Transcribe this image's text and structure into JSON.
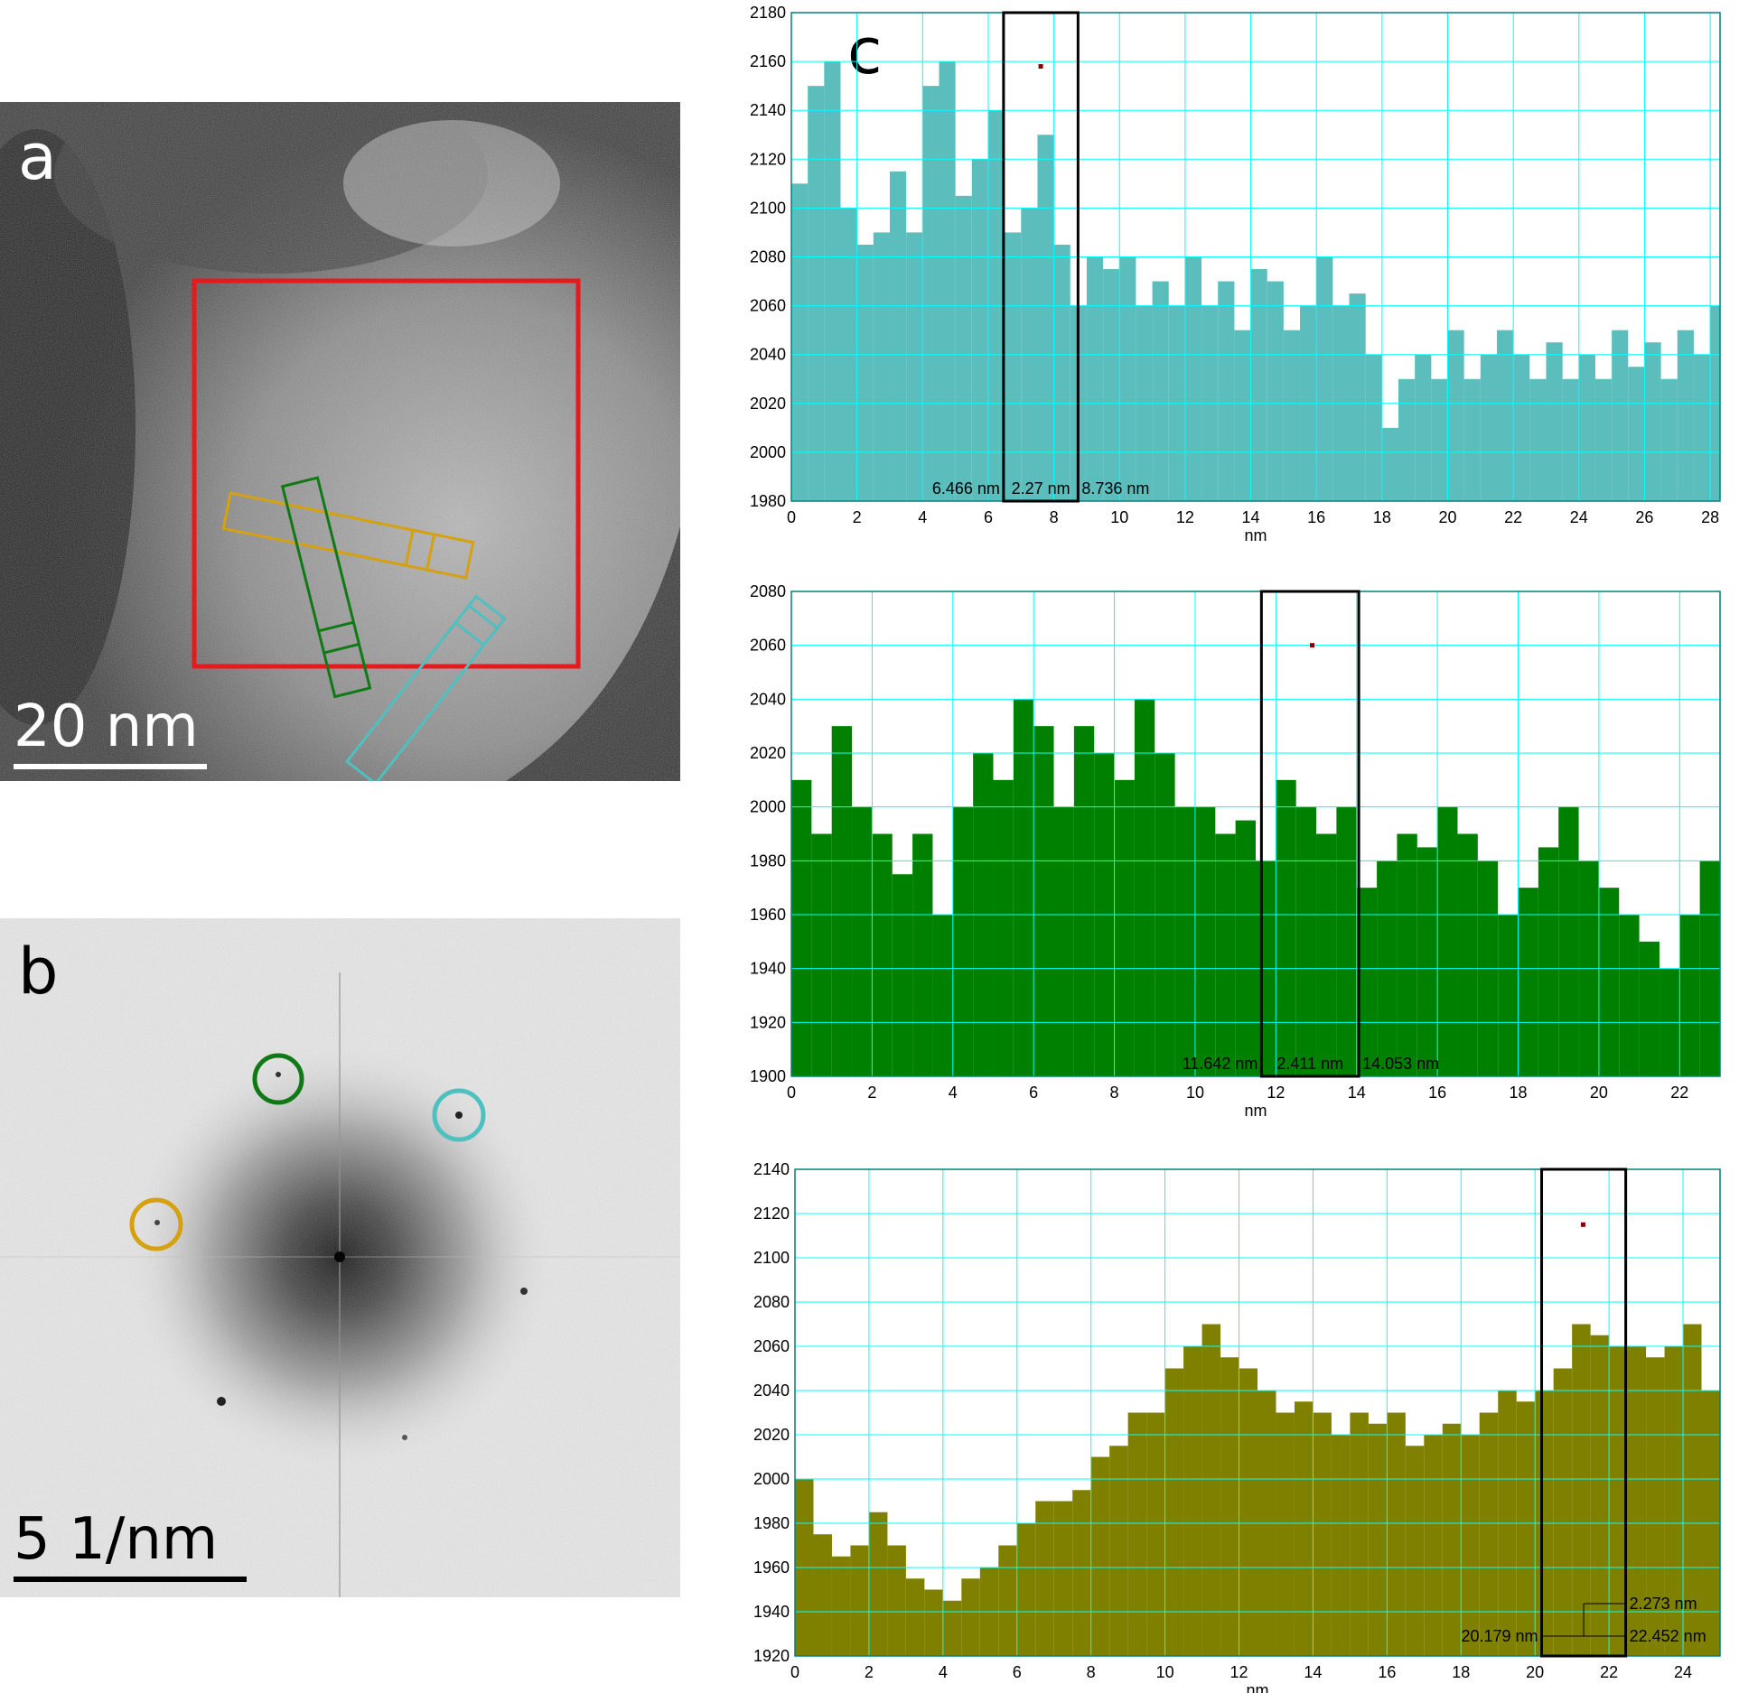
{
  "panel_a": {
    "letter": "a",
    "scale_label": "20 nm",
    "colors": {
      "roi": "#e8191e",
      "gold": "#d6a10e",
      "teal": "#4fc0c0",
      "green": "#0f7a15"
    }
  },
  "panel_b": {
    "letter": "b",
    "scale_label": "5 1/nm",
    "colors": {
      "gold": "#d6a10e",
      "teal": "#4fc0c0",
      "green": "#0f7a15"
    }
  },
  "panel_c": {
    "letter": "c"
  },
  "chart_data": [
    {
      "type": "bar",
      "xlabel": "nm",
      "ylabel": "",
      "xlim": [
        0,
        28.3
      ],
      "ylim": [
        1980,
        2180
      ],
      "xticks": [
        0,
        2,
        4,
        6,
        8,
        10,
        12,
        14,
        16,
        18,
        20,
        22,
        24,
        26,
        28
      ],
      "yticks": [
        1980,
        2000,
        2020,
        2040,
        2060,
        2080,
        2100,
        2120,
        2140,
        2160,
        2180
      ],
      "color": "#5cbdbd",
      "grid": true,
      "selection": [
        6.466,
        8.736
      ],
      "measure_text": [
        "6.466 nm",
        "2.27 nm",
        "8.736 nm"
      ],
      "marker": [
        7.6,
        2158
      ],
      "x": [
        0.0,
        0.5,
        1.0,
        1.5,
        2.0,
        2.5,
        3.0,
        3.5,
        4.0,
        4.5,
        5.0,
        5.5,
        6.0,
        6.5,
        7.0,
        7.5,
        8.0,
        8.5,
        9.0,
        9.5,
        10.0,
        10.5,
        11.0,
        11.5,
        12.0,
        12.5,
        13.0,
        13.5,
        14.0,
        14.5,
        15.0,
        15.5,
        16.0,
        16.5,
        17.0,
        17.5,
        18.0,
        18.5,
        19.0,
        19.5,
        20.0,
        20.5,
        21.0,
        21.5,
        22.0,
        22.5,
        23.0,
        23.5,
        24.0,
        24.5,
        25.0,
        25.5,
        26.0,
        26.5,
        27.0,
        27.5,
        28.0
      ],
      "y": [
        2110,
        2150,
        2160,
        2100,
        2085,
        2090,
        2115,
        2090,
        2150,
        2160,
        2105,
        2120,
        2140,
        2090,
        2100,
        2130,
        2085,
        2060,
        2080,
        2075,
        2080,
        2060,
        2070,
        2060,
        2080,
        2060,
        2070,
        2050,
        2075,
        2070,
        2050,
        2060,
        2080,
        2060,
        2065,
        2040,
        2010,
        2030,
        2040,
        2030,
        2050,
        2030,
        2040,
        2050,
        2040,
        2030,
        2045,
        2030,
        2040,
        2030,
        2050,
        2035,
        2045,
        2030,
        2050,
        2040,
        2060
      ]
    },
    {
      "type": "bar",
      "xlabel": "nm",
      "ylabel": "",
      "xlim": [
        0,
        23
      ],
      "ylim": [
        1900,
        2080
      ],
      "xticks": [
        0,
        2,
        4,
        6,
        8,
        10,
        12,
        14,
        16,
        18,
        20,
        22
      ],
      "yticks": [
        1900,
        1920,
        1940,
        1960,
        1980,
        2000,
        2020,
        2040,
        2060,
        2080
      ],
      "color": "#008000",
      "grid": true,
      "selection": [
        11.642,
        14.053
      ],
      "measure_text": [
        "11.642 nm",
        "2.411 nm",
        "14.053 nm"
      ],
      "marker": [
        12.9,
        2060
      ],
      "x": [
        0.0,
        0.5,
        1.0,
        1.5,
        2.0,
        2.5,
        3.0,
        3.5,
        4.0,
        4.5,
        5.0,
        5.5,
        6.0,
        6.5,
        7.0,
        7.5,
        8.0,
        8.5,
        9.0,
        9.5,
        10.0,
        10.5,
        11.0,
        11.5,
        12.0,
        12.5,
        13.0,
        13.5,
        14.0,
        14.5,
        15.0,
        15.5,
        16.0,
        16.5,
        17.0,
        17.5,
        18.0,
        18.5,
        19.0,
        19.5,
        20.0,
        20.5,
        21.0,
        21.5,
        22.0,
        22.5
      ],
      "y": [
        2010,
        1990,
        2030,
        2000,
        1990,
        1975,
        1990,
        1960,
        2000,
        2020,
        2010,
        2040,
        2030,
        2000,
        2030,
        2020,
        2010,
        2040,
        2020,
        2000,
        2000,
        1990,
        1995,
        1980,
        2010,
        2000,
        1990,
        2000,
        1970,
        1980,
        1990,
        1985,
        2000,
        1990,
        1980,
        1960,
        1970,
        1985,
        2000,
        1980,
        1970,
        1960,
        1950,
        1940,
        1960,
        1980
      ]
    },
    {
      "type": "bar",
      "xlabel": "nm",
      "ylabel": "",
      "xlim": [
        0,
        25
      ],
      "ylim": [
        1920,
        2140
      ],
      "xticks": [
        0,
        2,
        4,
        6,
        8,
        10,
        12,
        14,
        16,
        18,
        20,
        22,
        24
      ],
      "yticks": [
        1920,
        1940,
        1960,
        1980,
        2000,
        2020,
        2040,
        2060,
        2080,
        2100,
        2120,
        2140
      ],
      "color": "#808000",
      "grid": true,
      "selection": [
        20.179,
        22.452
      ],
      "measure_text": [
        "2.273 nm",
        "20.179 nm",
        "22.452 nm"
      ],
      "marker": [
        21.3,
        2115
      ],
      "x": [
        0.0,
        0.5,
        1.0,
        1.5,
        2.0,
        2.5,
        3.0,
        3.5,
        4.0,
        4.5,
        5.0,
        5.5,
        6.0,
        6.5,
        7.0,
        7.5,
        8.0,
        8.5,
        9.0,
        9.5,
        10.0,
        10.5,
        11.0,
        11.5,
        12.0,
        12.5,
        13.0,
        13.5,
        14.0,
        14.5,
        15.0,
        15.5,
        16.0,
        16.5,
        17.0,
        17.5,
        18.0,
        18.5,
        19.0,
        19.5,
        20.0,
        20.5,
        21.0,
        21.5,
        22.0,
        22.5,
        23.0,
        23.5,
        24.0,
        24.5
      ],
      "y": [
        2000,
        1975,
        1965,
        1970,
        1985,
        1970,
        1955,
        1950,
        1945,
        1955,
        1960,
        1970,
        1980,
        1990,
        1990,
        1995,
        2010,
        2015,
        2030,
        2030,
        2050,
        2060,
        2070,
        2055,
        2050,
        2040,
        2030,
        2035,
        2030,
        2020,
        2030,
        2025,
        2030,
        2015,
        2020,
        2025,
        2020,
        2030,
        2040,
        2035,
        2040,
        2050,
        2070,
        2065,
        2060,
        2060,
        2055,
        2060,
        2070,
        2040
      ]
    }
  ]
}
